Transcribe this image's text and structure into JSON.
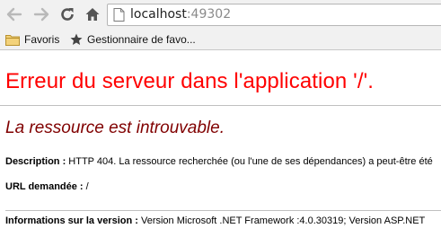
{
  "browser": {
    "url_host": "localhost",
    "url_port": ":49302",
    "bookmarks": [
      {
        "label": "Favoris",
        "icon": "folder-icon"
      },
      {
        "label": "Gestionnaire de favo...",
        "icon": "star-icon"
      }
    ]
  },
  "page": {
    "title": "Erreur du serveur dans l'application '/'.",
    "subtitle": "La ressource est introuvable.",
    "description_label": "Description :",
    "description_text": " HTTP 404. La ressource recherchée (ou l'une de ses dépendances) a peut-être été",
    "url_label": "URL demandée :",
    "url_value": " /",
    "version_label": "Informations sur la version :",
    "version_text": " Version Microsoft .NET Framework :4.0.30319; Version ASP.NET"
  },
  "colors": {
    "title": "#ff0000",
    "subtitle": "#800000",
    "chrome": "#f1f1f1"
  }
}
